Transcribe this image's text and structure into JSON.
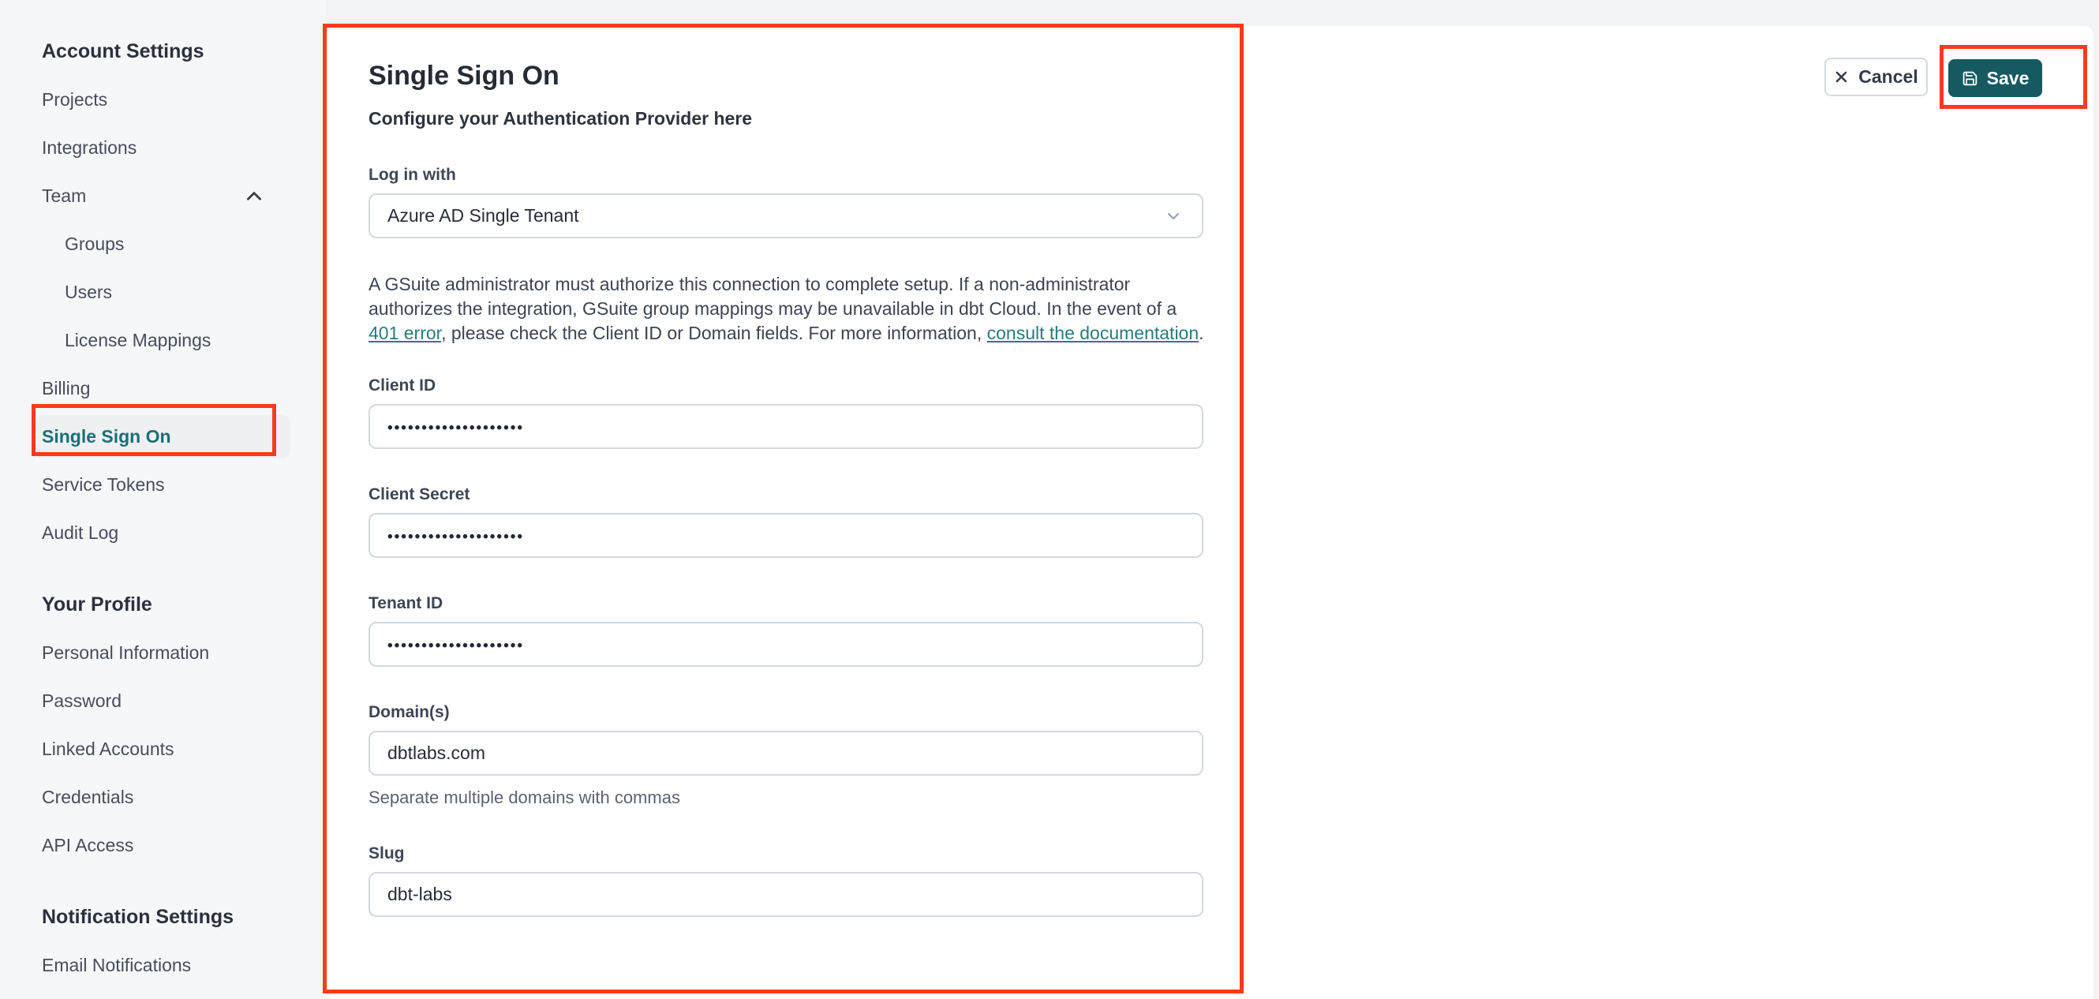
{
  "sidebar": {
    "sections": [
      {
        "header": "Account Settings",
        "items": [
          {
            "label": "Projects"
          },
          {
            "label": "Integrations"
          },
          {
            "label": "Team",
            "icon": "chevron-up-icon",
            "expanded": true
          },
          {
            "label": "Groups",
            "indent": true
          },
          {
            "label": "Users",
            "indent": true
          },
          {
            "label": "License Mappings",
            "indent": true
          },
          {
            "label": "Billing"
          },
          {
            "label": "Single Sign On",
            "selected": true
          },
          {
            "label": "Service Tokens"
          },
          {
            "label": "Audit Log"
          }
        ]
      },
      {
        "header": "Your Profile",
        "items": [
          {
            "label": "Personal Information"
          },
          {
            "label": "Password"
          },
          {
            "label": "Linked Accounts"
          },
          {
            "label": "Credentials"
          },
          {
            "label": "API Access"
          }
        ]
      },
      {
        "header": "Notification Settings",
        "items": [
          {
            "label": "Email Notifications"
          }
        ]
      }
    ]
  },
  "actions": {
    "cancel_label": "Cancel",
    "cancel_icon": "close-icon",
    "save_label": "Save",
    "save_icon": "save-icon"
  },
  "main": {
    "title": "Single Sign On",
    "subtitle": "Configure your Authentication Provider here",
    "login_with": {
      "label": "Log in with",
      "value": "Azure AD Single Tenant",
      "icon": "chevron-down-icon"
    },
    "notice": {
      "text_1": "A GSuite administrator must authorize this connection to complete setup. If a non-administrator authorizes the integration, GSuite group mappings may be unavailable in dbt Cloud. In the event of a ",
      "link_1": "401 error",
      "text_2": ", please check the Client ID or Domain fields. For more information, ",
      "link_2": "consult the documentation",
      "text_3": "."
    },
    "fields": [
      {
        "label": "Client ID",
        "value": "••••••••••••••••••••",
        "masked": true
      },
      {
        "label": "Client Secret",
        "value": "••••••••••••••••••••",
        "masked": true
      },
      {
        "label": "Tenant ID",
        "value": "••••••••••••••••••••",
        "masked": true
      },
      {
        "label": "Domain(s)",
        "value": "dbtlabs.com",
        "helper": "Separate multiple domains with commas"
      },
      {
        "label": "Slug",
        "value": "dbt-labs"
      }
    ]
  },
  "colors": {
    "annotation_red": "#f93b1d",
    "save_teal": "#165a61",
    "link_teal": "#2b7a80",
    "selected_teal": "#197076",
    "sidebar_bg": "#f6f7f8",
    "card_bg": "#ffffff"
  }
}
